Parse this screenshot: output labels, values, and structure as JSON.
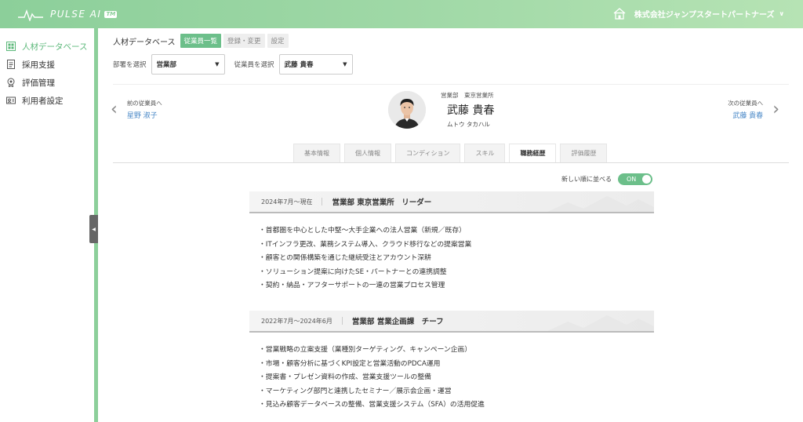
{
  "header": {
    "app_name": "PULSE AI",
    "tm": "TM",
    "company": "株式会社ジャンプスタートパートナーズ",
    "company_chevron": "∨"
  },
  "sidebar": {
    "items": [
      {
        "label": "人材データベース",
        "icon": "people-grid-icon",
        "active": true
      },
      {
        "label": "採用支援",
        "icon": "document-icon",
        "active": false
      },
      {
        "label": "評価管理",
        "icon": "medal-icon",
        "active": false
      },
      {
        "label": "利用者設定",
        "icon": "user-card-icon",
        "active": false
      }
    ],
    "collapse_glyph": "◀"
  },
  "topbar": {
    "title": "人材データベース",
    "tabs": [
      "従業員一覧",
      "登録・変更",
      "設定"
    ],
    "active_tab": 0
  },
  "filters": {
    "dept_label": "部署を選択",
    "dept_value": "営業部",
    "emp_label": "従業員を選択",
    "emp_value": "武藤 貴春",
    "arrow": "▼"
  },
  "nav": {
    "prev_label": "前の従業員へ",
    "prev_name": "星野 淑子",
    "next_label": "次の従業員へ",
    "next_name": "武藤 貴春",
    "prev_chevron": "‹",
    "next_chevron": "›"
  },
  "employee": {
    "department": "営業部　東京営業所",
    "name": "武藤 貴春",
    "kana": "ムトウ タカハル"
  },
  "tabs": {
    "items": [
      "基本情報",
      "個人情報",
      "コンディション",
      "スキル",
      "職務経歴",
      "評価履歴"
    ],
    "active": 4
  },
  "sort": {
    "label": "新しい順に並べる",
    "toggle": "ON"
  },
  "careers": [
    {
      "period": "2024年7月〜現在",
      "role": "営業部 東京営業所　リーダー",
      "duties": [
        "・首都圏を中心とした中堅〜大手企業への法人営業（新規／既存）",
        "・ITインフラ更改、業務システム導入、クラウド移行などの提案営業",
        "・顧客との関係構築を通じた継続受注とアカウント深耕",
        "・ソリューション提案に向けたSE・パートナーとの連携調整",
        "・契約・納品・アフターサポートの一連の営業プロセス管理"
      ]
    },
    {
      "period": "2022年7月〜2024年6月",
      "role": "営業部 営業企画課　チーフ",
      "duties": [
        "・営業戦略の立案支援（業種別ターゲティング、キャンペーン企画）",
        "・市場・顧客分析に基づくKPI設定と営業活動のPDCA運用",
        "・提案書・プレゼン資料の作成、営業支援ツールの整備",
        "・マーケティング部門と連携したセミナー／展示会企画・運営",
        "・見込み顧客データベースの整備、営業支援システム（SFA）の活用促進"
      ]
    }
  ],
  "colors": {
    "accent": "#6cbf8a",
    "header_green": "#8ccf9a",
    "link_blue": "#4a88c7"
  }
}
